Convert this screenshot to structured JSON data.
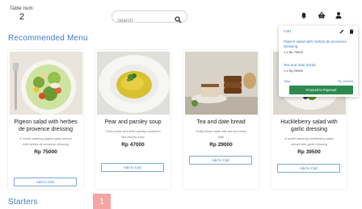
{
  "header": {
    "table_label": "Table num:",
    "table_number": "2",
    "search_placeholder": "Search",
    "icons": [
      "bell-icon",
      "basket-icon",
      "user-icon",
      "search-icon"
    ]
  },
  "sections": {
    "recommended": "Recommended Menu",
    "starters": "Starters"
  },
  "menu": [
    {
      "name": "Pigeon salad with herbes de provence dressing",
      "description": "A mouth watering pigeon salad served with herbes de provence dressing",
      "price": "Rp 75000",
      "button": "Add to Cart"
    },
    {
      "name": "Pear and parsley soup",
      "description": "Fresh pears and dried parsley combined like chunky soup",
      "price": "Rp 47000",
      "button": "Add to Cart"
    },
    {
      "name": "Tea and date bread",
      "description": "Fluffy bread made with tea and moist date",
      "price": "Rp 29000",
      "button": "Add to Cart"
    },
    {
      "name": "Huckleberry salad with garlic dressing",
      "description": "A mouth watering huckleberry salad served with garlic dressing",
      "price": "Rp 39500",
      "button": "Add to Cart"
    }
  ],
  "cart": {
    "title": "Cart",
    "items": [
      {
        "name": "Pigeon salad with herbes de provence dressing",
        "qty": "1 x Rp 75000"
      },
      {
        "name": "Tea and date bread",
        "qty": "1 x Rp 29000"
      }
    ],
    "total_label": "Total",
    "total_value": "Rp 104000",
    "pay_button": "Proceed to Payment"
  },
  "page_badge": "1",
  "colors": {
    "accent": "#3e7cc7",
    "pay": "#2d8a4e",
    "badge": "#f6a4a4"
  }
}
